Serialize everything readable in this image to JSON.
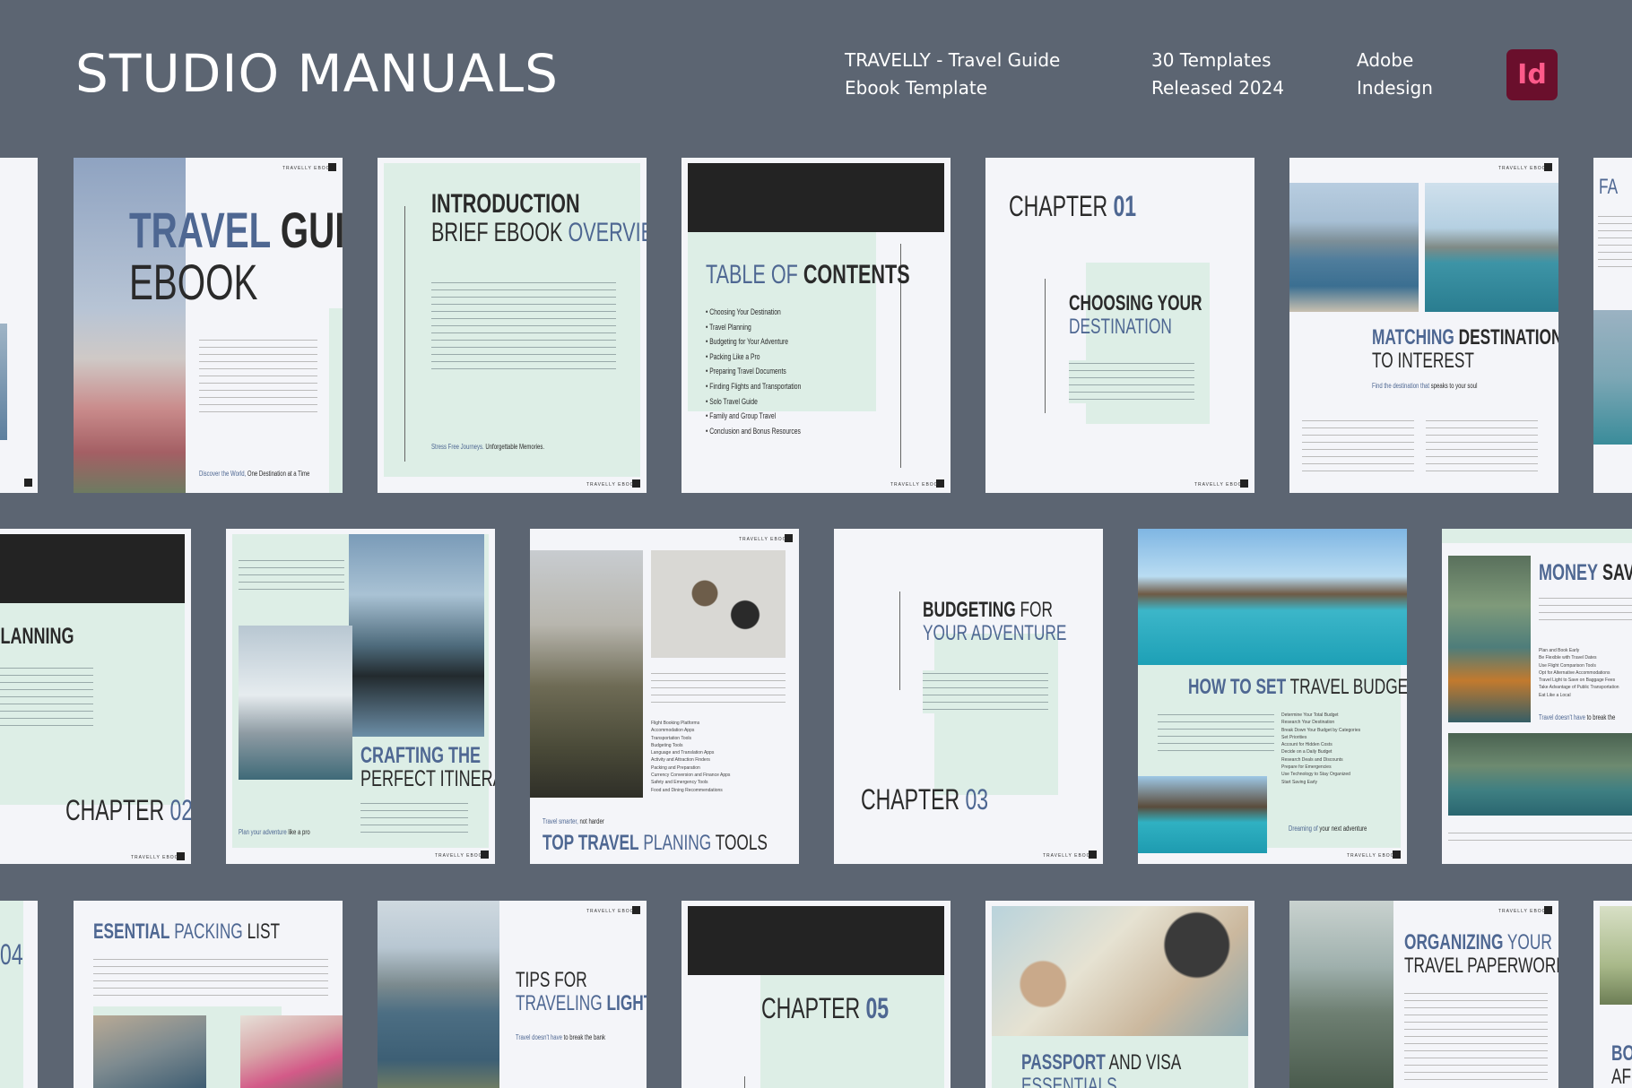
{
  "header": {
    "brand": "STUDIO MANUALS",
    "product_line1": "TRAVELLY - Travel Guide",
    "product_line2": "Ebook Template",
    "count_line1": "30 Templates",
    "count_line2": "Released 2024",
    "app_line1": "Adobe",
    "app_line2": "Indesign",
    "app_badge": "Id"
  },
  "brand_tag": "TRAVELLY EBOOK",
  "cover": {
    "title_a": "TRAVEL",
    "title_b": "GUIDE",
    "title_c": "EBOOK",
    "foot_a": "Discover the World,",
    "foot_b": "One Destination at a Time"
  },
  "intro": {
    "title_a": "INTRODUCTION",
    "title_b": "BRIEF EBOOK",
    "title_c": "OVERVIEW",
    "foot_a": "Stress Free Journeys.",
    "foot_b": "Unforgettable Memories."
  },
  "toc": {
    "title_a": "TABLE OF",
    "title_b": "CONTENTS",
    "items": [
      "• Choosing Your Destination",
      "• Travel Planning",
      "• Budgeting for Your Adventure",
      "• Packing Like a Pro",
      "• Preparing Travel Documents",
      "• Finding Flights and Transportation",
      "• Solo Travel Guide",
      "• Family and Group Travel",
      "• Conclusion and Bonus Resources"
    ]
  },
  "ch1": {
    "chapter_a": "CHAPTER",
    "chapter_b": "01",
    "title_a": "CHOOSING YOUR",
    "title_b": "DESTINATION"
  },
  "matching": {
    "title_a": "MATCHING",
    "title_b": "DESTINATIONS",
    "title_c": "TO INTEREST",
    "sub_a": "Find the destination that",
    "sub_b": "speaks to your soul"
  },
  "row2": {
    "planning_title": "PLANNING",
    "ch2_a": "CHAPTER",
    "ch2_b": "02",
    "crafting_a": "CRAFTING THE",
    "crafting_b": "PERFECT ITINERARY",
    "crafting_foot_a": "Plan your adventure",
    "crafting_foot_b": "like a pro",
    "tools_small_a": "Travel smarter,",
    "tools_small_b": "not harder",
    "tools_a": "TOP TRAVEL",
    "tools_b": "PLANING",
    "tools_c": "TOOLS",
    "tools_list": [
      "Flight Booking Platforms",
      "Accommodation Apps",
      "Transportation Tools",
      "Budgeting Tools",
      "Language and Translation Apps",
      "Activity and Attraction Finders",
      "Packing and Preparation",
      "Currency Conversion and Finance Apps",
      "Safety and Emergency Tools",
      "Food and Dining Recommendations"
    ],
    "budget_a": "BUDGETING",
    "budget_b": "FOR",
    "budget_c": "YOUR ADVENTURE",
    "ch3_a": "CHAPTER",
    "ch3_b": "03",
    "setbudget_a": "HOW TO",
    "setbudget_b": "SET",
    "setbudget_c": "TRAVEL BUDGET",
    "setbudget_list": [
      "Determine Your Total Budget",
      "Research Your Destination",
      "Break Down Your Budget by Categories",
      "Set Priorities",
      "Account for Hidden Costs",
      "Decide on a Daily Budget",
      "Research Deals and Discounts",
      "Prepare for Emergencies",
      "Use Technology to Stay Organized",
      "Start Saving Early"
    ],
    "setbudget_foot_a": "Dreaming of",
    "setbudget_foot_b": "your next adventure",
    "money_a": "MONEY",
    "money_b": "SAVIN",
    "money_list": [
      "Plan and Book Early",
      "Be Flexible with Travel Dates",
      "Use Flight Comparison Tools",
      "Opt for Alternative Accommodations",
      "Travel Light to Save on Baggage Fees",
      "Take Advantage of Public Transportation",
      "Eat Like a Local"
    ],
    "money_foot_a": "Travel doesn't have",
    "money_foot_b": "to break the"
  },
  "row3": {
    "ch4_b": "04",
    "packing_a": "ESENTIAL",
    "packing_b": "PACKING",
    "packing_c": "LIST",
    "tips_a": "TIPS FOR",
    "tips_b": "TRAVELING",
    "tips_c": "LIGHT",
    "tips_foot_a": "Travel doesn't have",
    "tips_foot_b": "to break the bank",
    "ch5_a": "CHAPTER",
    "ch5_b": "05",
    "passport_a": "PASSPORT",
    "passport_b": "AND VISA",
    "passport_c": "ESSENTIALS",
    "paperwork_a": "ORGANIZING",
    "paperwork_b": "YOUR",
    "paperwork_c": "TRAVEL PAPERWORK",
    "edge_a": "BOO",
    "edge_b": "AFF",
    "edge_top": "FA"
  },
  "colors": {
    "background": "#5c6572",
    "accent_blue": "#4e6792",
    "mint": "#ddeee6",
    "dark_block": "#232323",
    "id_badge": "#6a0f2c"
  }
}
